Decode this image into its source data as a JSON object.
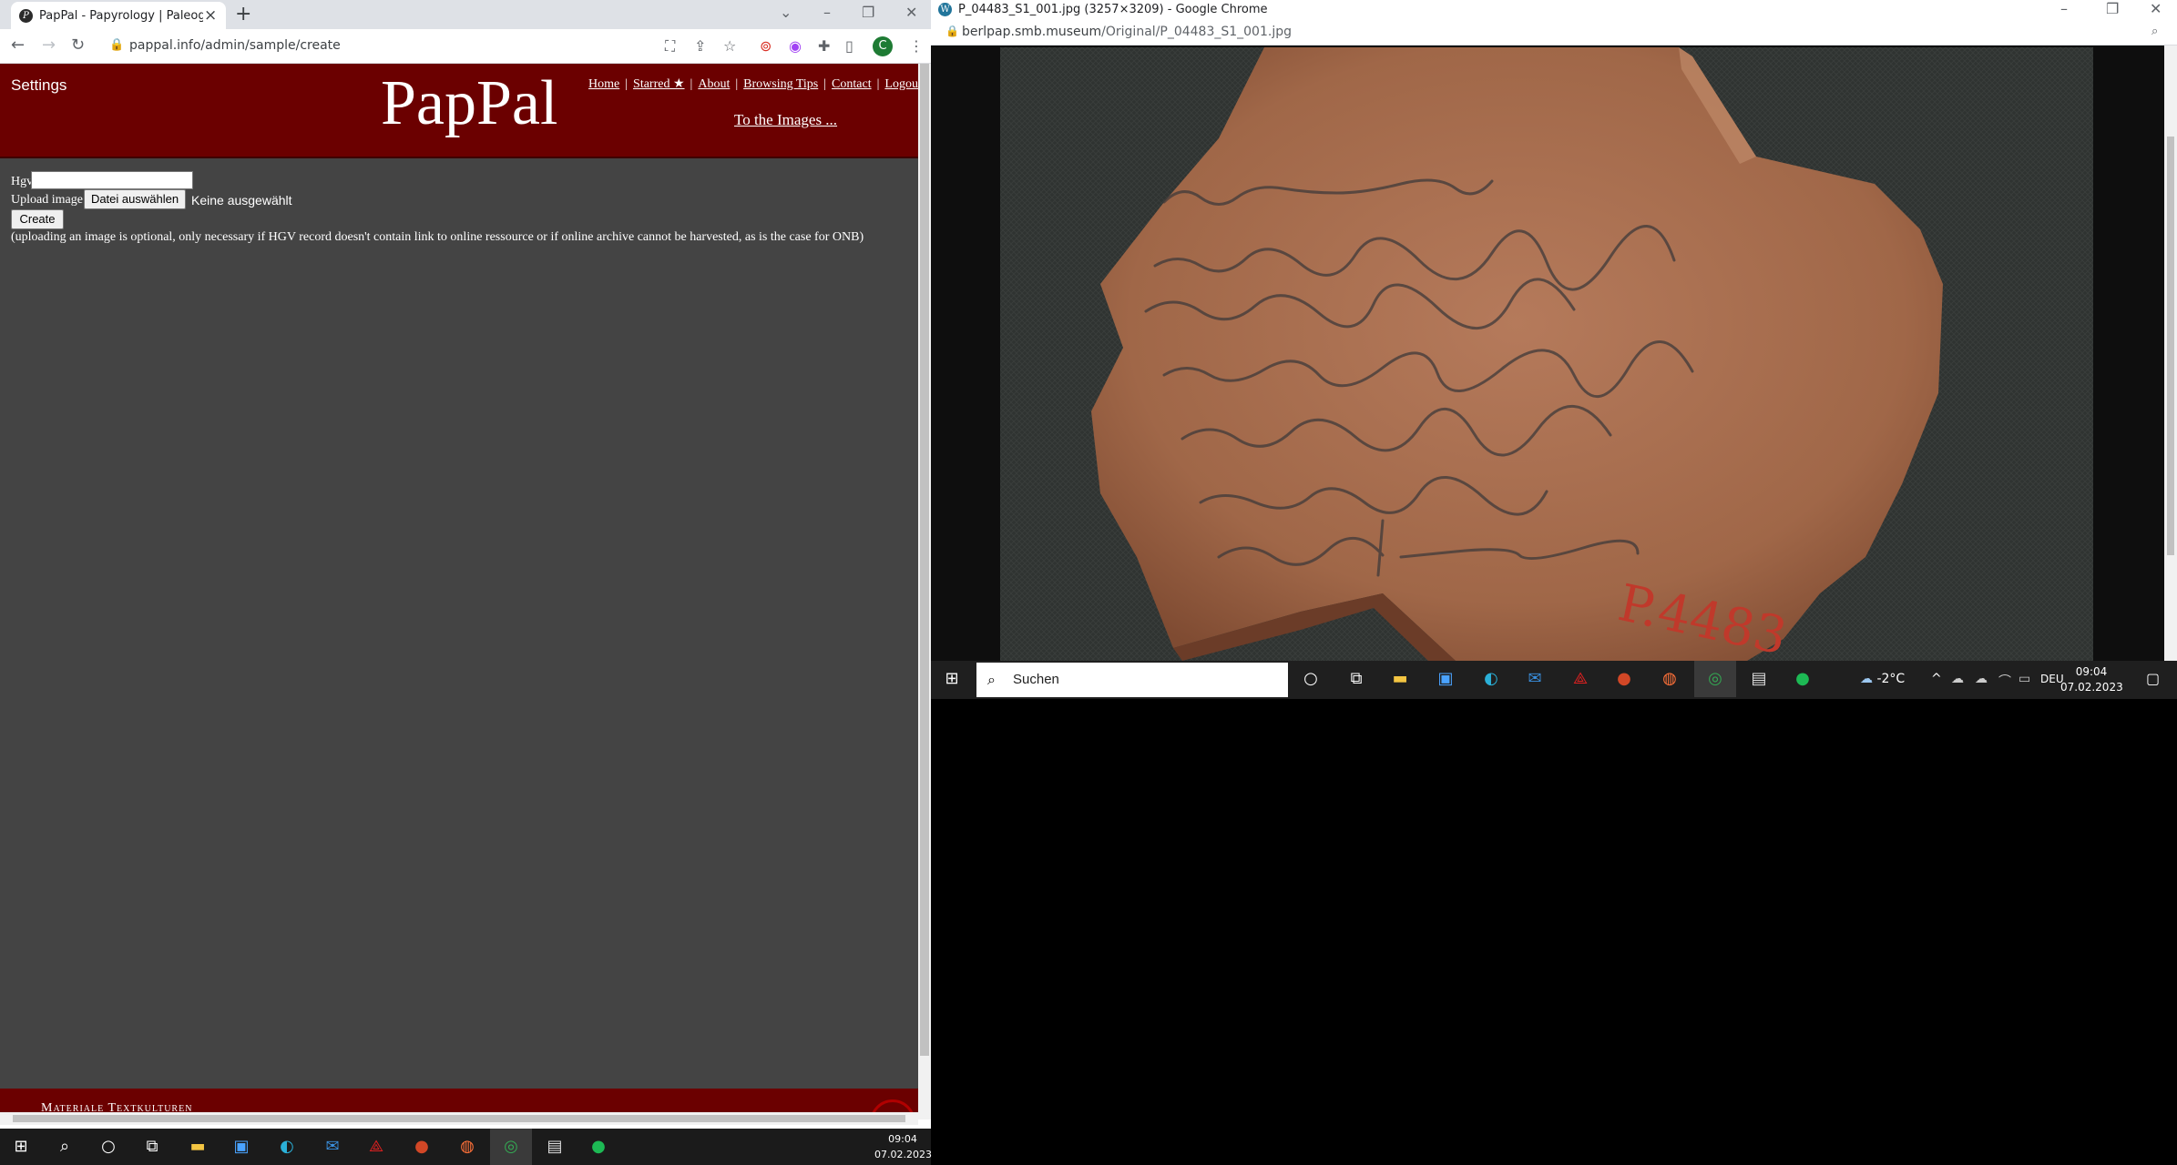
{
  "left_browser": {
    "tab_title": "PapPal - Papyrology | Paleograph",
    "tab_favicon": "pappal-favicon",
    "url": "pappal.info/admin/sample/create",
    "profile_initial": "C"
  },
  "site": {
    "settings_label": "Settings",
    "logo": "PapPal",
    "nav": [
      "Home",
      "Starred ★",
      "About",
      "Browsing Tips",
      "Contact",
      "Logout"
    ],
    "to_images_link": "To the Images ...",
    "form": {
      "hgv_label": "Hgv",
      "hgv_value": "",
      "upload_label": "Upload image",
      "file_button_label": "Datei auswählen",
      "file_status": "Keine ausgewählt",
      "create_button_label": "Create",
      "hint": "(uploading an image is optional, only necessary if HGV record doesn't contain link to online ressource or if online archive cannot be harvested, as is the case for ONB)"
    },
    "footer_text": "Materiale Textkulturen",
    "header_color": "#6b0000",
    "body_color": "#444444"
  },
  "left_taskbar": {
    "time": "09:04",
    "date": "07.02.2023"
  },
  "right_browser": {
    "window_title": "P_04483_S1_001.jpg (3257×3209) - Google Chrome",
    "url_host": "berlpap.smb.museum",
    "url_path": "/Original/P_04483_S1_001.jpg",
    "photo_label": "P.4483"
  },
  "right_taskbar": {
    "search_placeholder": "Suchen",
    "weather": "-2°C",
    "language": "DEU",
    "time": "09:04",
    "date": "07.02.2023"
  }
}
